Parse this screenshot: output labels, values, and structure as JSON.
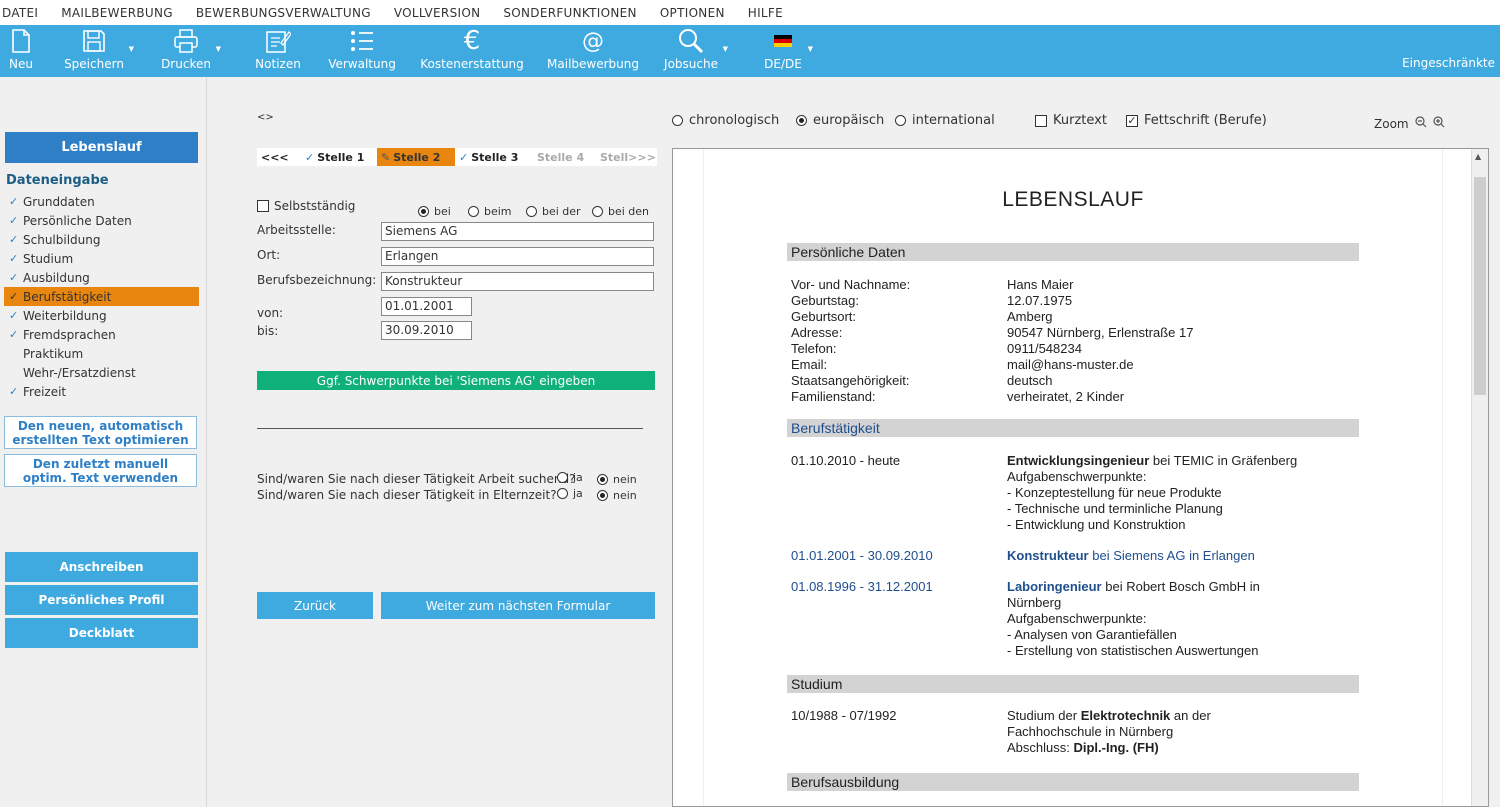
{
  "menu": [
    "DATEI",
    "MAILBEWERBUNG",
    "BEWERBUNGSVERWALTUNG",
    "VOLLVERSION",
    "SONDERFUNKTIONEN",
    "OPTIONEN",
    "HILFE"
  ],
  "toolbar": {
    "neu": "Neu",
    "speichern": "Speichern",
    "drucken": "Drucken",
    "notizen": "Notizen",
    "verwaltung": "Verwaltung",
    "kostenerstattung": "Kostenerstattung",
    "mailbewerbung": "Mailbewerbung",
    "jobsuche": "Jobsuche",
    "language": "DE/DE",
    "restricted": "Eingeschränkte",
    "euro_glyph": "€",
    "at_glyph": "@"
  },
  "sidebar": {
    "lebenslauf": "Lebenslauf",
    "section_title": "Dateneingabe",
    "items": [
      {
        "label": "Grunddaten",
        "check": "✓"
      },
      {
        "label": "Persönliche Daten",
        "check": "✓"
      },
      {
        "label": "Schulbildung",
        "check": "✓"
      },
      {
        "label": "Studium",
        "check": "✓"
      },
      {
        "label": "Ausbildung",
        "check": "✓"
      },
      {
        "label": "Berufstätigkeit",
        "check": "✓"
      },
      {
        "label": "Weiterbildung",
        "check": "✓"
      },
      {
        "label": "Fremdsprachen",
        "check": "✓"
      },
      {
        "label": "Praktikum",
        "check": ""
      },
      {
        "label": "Wehr-/Ersatzdienst",
        "check": ""
      },
      {
        "label": "Freizeit",
        "check": "✓"
      }
    ],
    "optimize_line1": "Den neuen, automatisch",
    "optimize_line2": "erstellten Text optimieren",
    "manual_line1": "Den zuletzt manuell",
    "manual_line2": "optim. Text verwenden",
    "anschreiben": "Anschreiben",
    "profil": "Persönliches Profil",
    "deckblatt": "Deckblatt"
  },
  "form": {
    "toggle": "<>",
    "steps": {
      "prev": "<<<",
      "s1": "Stelle 1",
      "s2": "Stelle 2",
      "s3": "Stelle 3",
      "s4": "Stelle 4",
      "s5": "Stell>>>",
      "check": "✓",
      "pencil": "✎"
    },
    "selbststaendig": "Selbstständig",
    "prepositions": [
      "bei",
      "beim",
      "bei der",
      "bei den"
    ],
    "arbeitsstelle_label": "Arbeitsstelle:",
    "arbeitsstelle_value": "Siemens AG",
    "ort_label": "Ort:",
    "ort_value": "Erlangen",
    "beruf_label": "Berufsbezeichnung:",
    "beruf_value": "Konstrukteur",
    "von_label": "von:",
    "von_value": "01.01.2001",
    "bis_label": "bis:",
    "bis_value": "30.09.2010",
    "schwerpunkte_button": "Ggf. Schwerpunkte bei 'Siemens AG' eingeben",
    "q1": "Sind/waren Sie nach dieser Tätigkeit Arbeit suchend?",
    "q2": "Sind/waren Sie nach dieser Tätigkeit in Elternzeit?",
    "ja": "ja",
    "nein": "nein",
    "zurueck": "Zurück",
    "weiter": "Weiter zum nächsten Formular"
  },
  "preview_options": {
    "chronologisch": "chronologisch",
    "europaeisch": "europäisch",
    "international": "international",
    "kurztext": "Kurztext",
    "fettschrift": "Fettschrift (Berufe)",
    "zoom": "Zoom"
  },
  "cv": {
    "title": "LEBENSLAUF",
    "sec_personal": "Persönliche Daten",
    "personal": [
      {
        "k": "Vor- und Nachname:",
        "v": "Hans Maier"
      },
      {
        "k": "Geburtstag:",
        "v": "12.07.1975"
      },
      {
        "k": "Geburtsort:",
        "v": "Amberg"
      },
      {
        "k": "Adresse:",
        "v": "90547 Nürnberg, Erlenstraße 17"
      },
      {
        "k": "Telefon:",
        "v": "0911/548234"
      },
      {
        "k": "Email:",
        "v": "mail@hans-muster.de"
      },
      {
        "k": "Staatsangehörigkeit:",
        "v": "deutsch"
      },
      {
        "k": "Familienstand:",
        "v": "verheiratet, 2 Kinder"
      }
    ],
    "sec_beruf": "Berufstätigkeit",
    "job1": {
      "date": "01.10.2010 - heute",
      "title": "Entwicklungsingenieur",
      "rest": " bei TEMIC in Gräfenberg",
      "l2": "Aufgabenschwerpunkte:",
      "l3": "- Konzeptestellung für neue Produkte",
      "l4": "- Technische und terminliche Planung",
      "l5": "- Entwicklung und Konstruktion"
    },
    "job2": {
      "date": "01.01.2001 - 30.09.2010",
      "title": "Konstrukteur",
      "rest": " bei Siemens AG in Erlangen"
    },
    "job3": {
      "date": "01.08.1996 - 31.12.2001",
      "title": "Laboringenieur",
      "rest": "  bei Robert Bosch GmbH in",
      "l2": "Nürnberg",
      "l3": "Aufgabenschwerpunkte:",
      "l4": "- Analysen von Garantiefällen",
      "l5": "- Erstellung von statistischen Auswertungen"
    },
    "sec_studium": "Studium",
    "study": {
      "date": "10/1988 - 07/1992",
      "pre": "Studium der ",
      "field": "Elektrotechnik",
      "post": " an der",
      "l2": "Fachhochschule in Nürnberg",
      "l3pre": "Abschluss: ",
      "l3b": "Dipl.-Ing. (FH)"
    },
    "sec_ausbildung": "Berufsausbildung"
  }
}
